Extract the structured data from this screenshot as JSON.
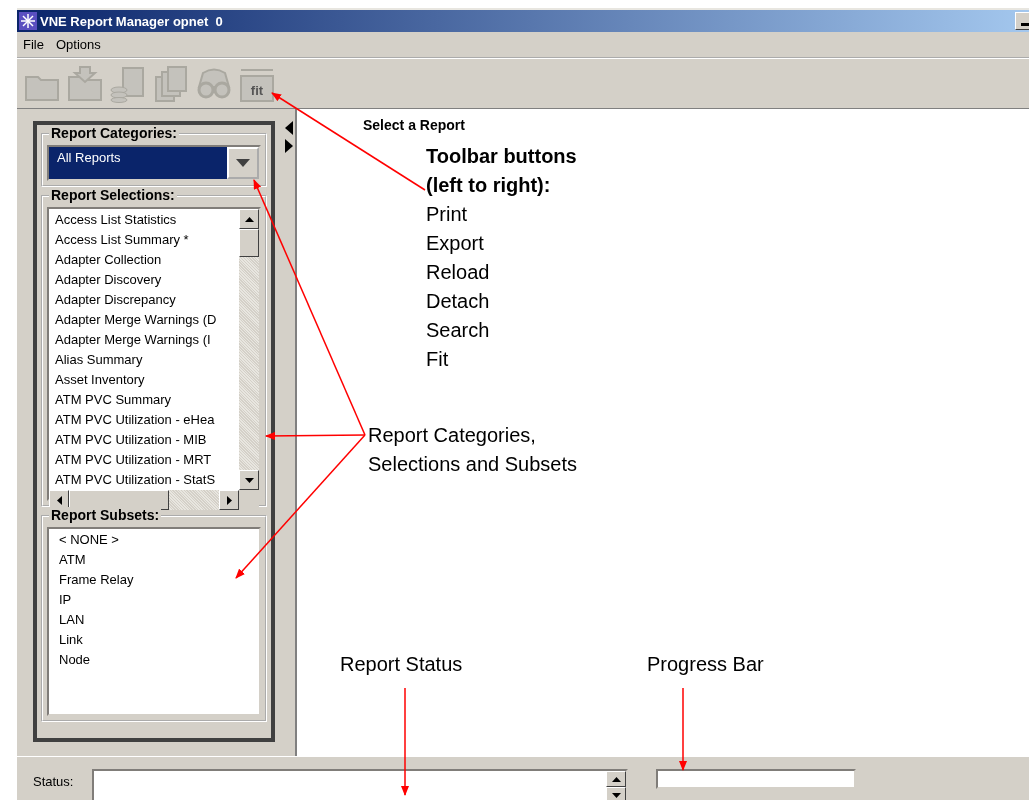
{
  "window": {
    "title": "VNE Report Manager opnet  0"
  },
  "menu": [
    {
      "label": "File"
    },
    {
      "label": "Options"
    }
  ],
  "toolbar": [
    {
      "kind": "folder",
      "disabled": true
    },
    {
      "kind": "export",
      "disabled": true
    },
    {
      "kind": "reload",
      "disabled": true
    },
    {
      "kind": "pages",
      "disabled": true
    },
    {
      "kind": "binoculars",
      "disabled": true
    },
    {
      "kind": "fit",
      "caption": "fit",
      "disabled": true
    }
  ],
  "report_categories": {
    "label": "Report Categories:",
    "value": "All Reports"
  },
  "report_selections": {
    "label": "Report Selections:",
    "items": [
      {
        "label": "Access List Statistics",
        "selected": false
      },
      {
        "label": "Access List Summary *",
        "selected": false
      },
      {
        "label": "Adapter Collection",
        "selected": false
      },
      {
        "label": "Adapter Discovery",
        "selected": false
      },
      {
        "label": "Adapter Discrepancy",
        "selected": false
      },
      {
        "label": "Adapter Merge Warnings (D",
        "selected": false
      },
      {
        "label": "Adapter Merge Warnings (I",
        "selected": false
      },
      {
        "label": "Alias Summary",
        "selected": false
      },
      {
        "label": "Asset Inventory",
        "selected": false
      },
      {
        "label": "ATM PVC Summary",
        "selected": false
      },
      {
        "label": "ATM PVC Utilization - eHea",
        "selected": false
      },
      {
        "label": "ATM PVC Utilization - MIB",
        "selected": false
      },
      {
        "label": "ATM PVC Utilization - MRT",
        "selected": false
      },
      {
        "label": "ATM PVC Utilization - StatS",
        "selected": false
      }
    ]
  },
  "report_subsets": {
    "label": "Report Subsets:",
    "items": [
      {
        "label": "< NONE >",
        "selected": false
      },
      {
        "label": "ATM",
        "selected": false
      },
      {
        "label": "Frame Relay",
        "selected": false
      },
      {
        "label": "IP",
        "selected": false
      },
      {
        "label": "LAN",
        "selected": false
      },
      {
        "label": "Link",
        "selected": false
      },
      {
        "label": "Node",
        "selected": false
      }
    ]
  },
  "content": {
    "heading": "Select a Report"
  },
  "annotations": [
    {
      "kind": "list",
      "title": "Toolbar buttons (left to right):",
      "lines": [
        "Print",
        "Export",
        "Reload",
        "Detach",
        "Search",
        "Fit"
      ]
    },
    {
      "kind": "note",
      "text": "Report Categories, Selections and Subsets"
    },
    {
      "kind": "note",
      "text": "Report Status"
    },
    {
      "kind": "note",
      "text": "Progress Bar"
    }
  ],
  "status_bar": {
    "label": "Status:"
  }
}
